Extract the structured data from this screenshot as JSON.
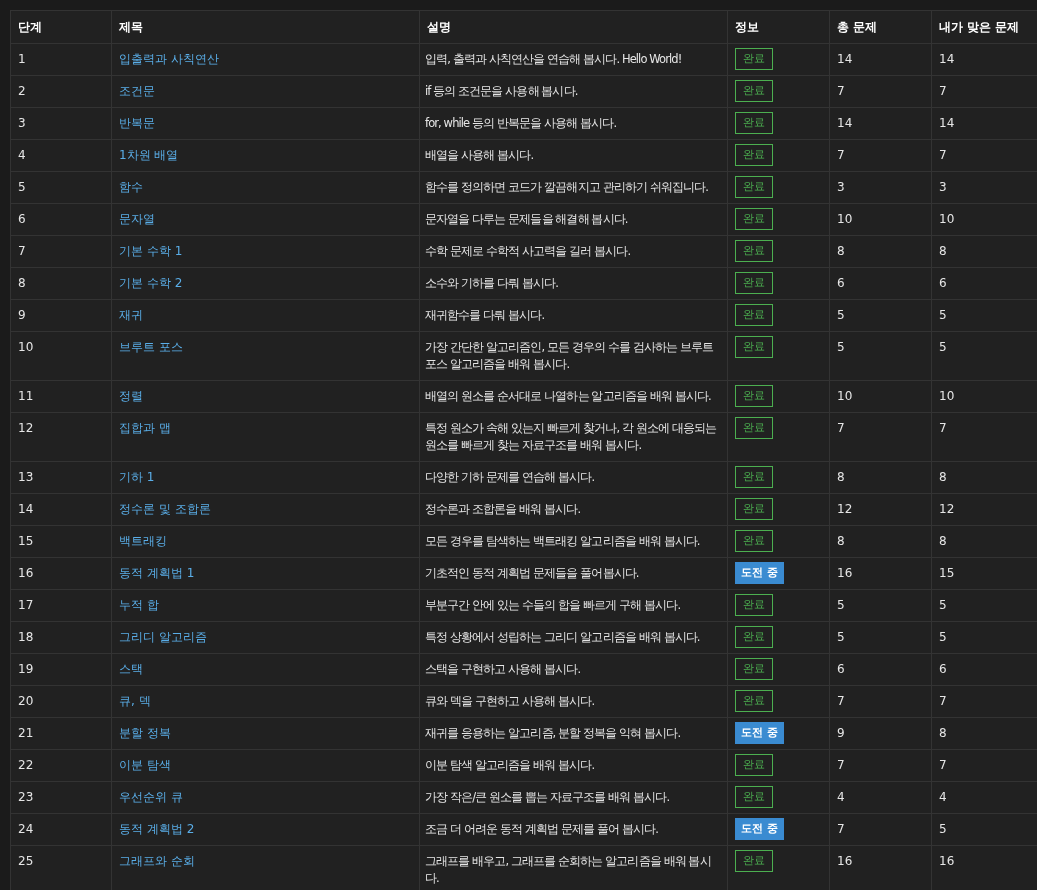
{
  "table": {
    "columns": [
      "단계",
      "제목",
      "설명",
      "정보",
      "총 문제",
      "내가 맞은 문제"
    ],
    "rows": [
      {
        "step": "1",
        "title": "입출력과 사칙연산",
        "description": "입력, 출력과 사칙연산을 연습해 봅시다. Hello World!",
        "status": {
          "kind": "done",
          "label": "완료"
        },
        "total": "14",
        "solved": "14"
      },
      {
        "step": "2",
        "title": "조건문",
        "description": "if 등의 조건문을 사용해 봅시다.",
        "status": {
          "kind": "done",
          "label": "완료"
        },
        "total": "7",
        "solved": "7"
      },
      {
        "step": "3",
        "title": "반복문",
        "description": "for, while 등의 반복문을 사용해 봅시다.",
        "status": {
          "kind": "done",
          "label": "완료"
        },
        "total": "14",
        "solved": "14"
      },
      {
        "step": "4",
        "title": "1차원 배열",
        "description": "배열을 사용해 봅시다.",
        "status": {
          "kind": "done",
          "label": "완료"
        },
        "total": "7",
        "solved": "7"
      },
      {
        "step": "5",
        "title": "함수",
        "description": "함수를 정의하면 코드가 깔끔해지고 관리하기 쉬워집니다.",
        "status": {
          "kind": "done",
          "label": "완료"
        },
        "total": "3",
        "solved": "3"
      },
      {
        "step": "6",
        "title": "문자열",
        "description": "문자열을 다루는 문제들을 해결해 봅시다.",
        "status": {
          "kind": "done",
          "label": "완료"
        },
        "total": "10",
        "solved": "10"
      },
      {
        "step": "7",
        "title": "기본 수학 1",
        "description": "수학 문제로 수학적 사고력을 길러 봅시다.",
        "status": {
          "kind": "done",
          "label": "완료"
        },
        "total": "8",
        "solved": "8"
      },
      {
        "step": "8",
        "title": "기본 수학 2",
        "description": "소수와 기하를 다뤄 봅시다.",
        "status": {
          "kind": "done",
          "label": "완료"
        },
        "total": "6",
        "solved": "6"
      },
      {
        "step": "9",
        "title": "재귀",
        "description": "재귀함수를 다뤄 봅시다.",
        "status": {
          "kind": "done",
          "label": "완료"
        },
        "total": "5",
        "solved": "5"
      },
      {
        "step": "10",
        "title": "브루트 포스",
        "description": "가장 간단한 알고리즘인, 모든 경우의 수를 검사하는 브루트 포스 알고리즘을 배워 봅시다.",
        "status": {
          "kind": "done",
          "label": "완료"
        },
        "total": "5",
        "solved": "5"
      },
      {
        "step": "11",
        "title": "정렬",
        "description": "배열의 원소를 순서대로 나열하는 알고리즘을 배워 봅시다.",
        "status": {
          "kind": "done",
          "label": "완료"
        },
        "total": "10",
        "solved": "10"
      },
      {
        "step": "12",
        "title": "집합과 맵",
        "description": "특정 원소가 속해 있는지 빠르게 찾거나, 각 원소에 대응되는 원소를 빠르게 찾는 자료구조를 배워 봅시다.",
        "status": {
          "kind": "done",
          "label": "완료"
        },
        "total": "7",
        "solved": "7"
      },
      {
        "step": "13",
        "title": "기하 1",
        "description": "다양한 기하 문제를 연습해 봅시다.",
        "status": {
          "kind": "done",
          "label": "완료"
        },
        "total": "8",
        "solved": "8"
      },
      {
        "step": "14",
        "title": "정수론 및 조합론",
        "description": "정수론과 조합론을 배워 봅시다.",
        "status": {
          "kind": "done",
          "label": "완료"
        },
        "total": "12",
        "solved": "12"
      },
      {
        "step": "15",
        "title": "백트래킹",
        "description": "모든 경우를 탐색하는 백트래킹 알고리즘을 배워 봅시다.",
        "status": {
          "kind": "done",
          "label": "완료"
        },
        "total": "8",
        "solved": "8"
      },
      {
        "step": "16",
        "title": "동적 계획법 1",
        "description": "기초적인 동적 계획법 문제들을 풀어봅시다.",
        "status": {
          "kind": "trying",
          "label": "도전 중"
        },
        "total": "16",
        "solved": "15"
      },
      {
        "step": "17",
        "title": "누적 합",
        "description": "부분구간 안에 있는 수들의 합을 빠르게 구해 봅시다.",
        "status": {
          "kind": "done",
          "label": "완료"
        },
        "total": "5",
        "solved": "5"
      },
      {
        "step": "18",
        "title": "그리디 알고리즘",
        "description": "특정 상황에서 성립하는 그리디 알고리즘을 배워 봅시다.",
        "status": {
          "kind": "done",
          "label": "완료"
        },
        "total": "5",
        "solved": "5"
      },
      {
        "step": "19",
        "title": "스택",
        "description": "스택을 구현하고 사용해 봅시다.",
        "status": {
          "kind": "done",
          "label": "완료"
        },
        "total": "6",
        "solved": "6"
      },
      {
        "step": "20",
        "title": "큐, 덱",
        "description": "큐와 덱을 구현하고 사용해 봅시다.",
        "status": {
          "kind": "done",
          "label": "완료"
        },
        "total": "7",
        "solved": "7"
      },
      {
        "step": "21",
        "title": "분할 정복",
        "description": "재귀를 응용하는 알고리즘, 분할 정복을 익혀 봅시다.",
        "status": {
          "kind": "trying",
          "label": "도전 중"
        },
        "total": "9",
        "solved": "8"
      },
      {
        "step": "22",
        "title": "이분 탐색",
        "description": "이분 탐색 알고리즘을 배워 봅시다.",
        "status": {
          "kind": "done",
          "label": "완료"
        },
        "total": "7",
        "solved": "7"
      },
      {
        "step": "23",
        "title": "우선순위 큐",
        "description": "가장 작은/큰 원소를 뽑는 자료구조를 배워 봅시다.",
        "status": {
          "kind": "done",
          "label": "완료"
        },
        "total": "4",
        "solved": "4"
      },
      {
        "step": "24",
        "title": "동적 계획법 2",
        "description": "조금 더 어려운 동적 계획법 문제를 풀어 봅시다.",
        "status": {
          "kind": "trying",
          "label": "도전 중"
        },
        "total": "7",
        "solved": "5"
      },
      {
        "step": "25",
        "title": "그래프와 순회",
        "description": "그래프를 배우고, 그래프를 순회하는 알고리즘을 배워 봅시다.",
        "status": {
          "kind": "done",
          "label": "완료"
        },
        "total": "16",
        "solved": "16"
      }
    ]
  }
}
